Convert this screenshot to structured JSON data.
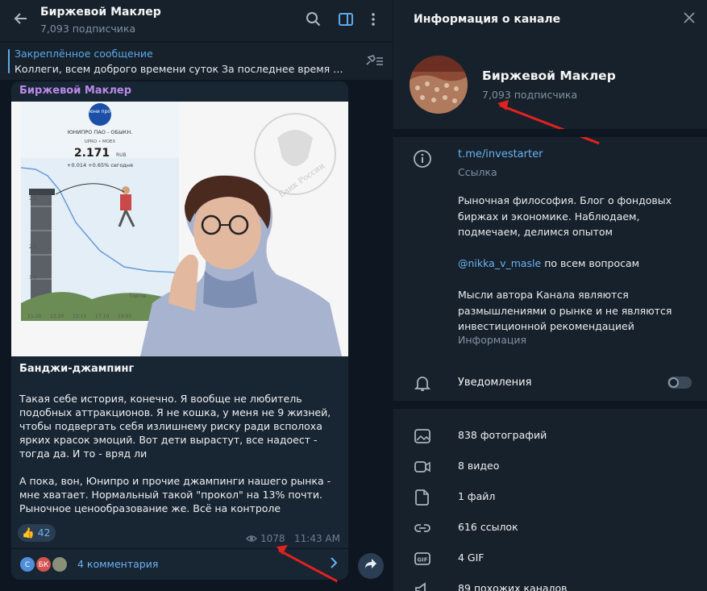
{
  "chat": {
    "title": "Биржевой Маклер",
    "subscribers": "7,093 подписчика"
  },
  "pinned": {
    "title": "Закреплённое сообщение",
    "text": "Коллеги, всем доброго времени суток  За последнее время к на..."
  },
  "post": {
    "author": "Биржевой Маклер",
    "image": {
      "ticker_name": "ЮНИПРО ПАО - ОБЫКН.",
      "ticker_code": "UPRO • MOEX",
      "logo_text": "юни про",
      "price": "2.171",
      "currency": "RUB",
      "change": "+0.014 +0.65% сегодня",
      "seal_text": "Банк России",
      "trade_label": "Торгов",
      "axis_y": [
        "2.2",
        "2.0",
        "1.9"
      ],
      "axis_x": [
        "11:20",
        "13:20",
        "15:15",
        "17:10",
        "19:05"
      ]
    },
    "heading": "Банджи-джампинг",
    "paragraphs": [
      "Такая себе история, конечно. Я вообще не любитель подобных аттракционов. Я не кошка, у меня не 9 жизней, чтобы подвергать себя излишнему риску ради всполоха ярких красок эмоций. Вот дети вырастут, все надоест - тогда да. И то - вряд ли",
      "А пока, вон, Юнипро и прочие джампинги нашего рынка - мне хватает. Нормальный такой \"прокол\" на 13% почти. Рыночное ценообразование же. Всё на контроле"
    ],
    "reaction_emoji": "👍",
    "reaction_count": "42",
    "views": "1078",
    "time": "11:43 AM",
    "comment_avatars": [
      "С",
      "БК"
    ],
    "comments_label": "4 комментария"
  },
  "info": {
    "title": "Информация о канале",
    "channel_name": "Биржевой Маклер",
    "subscribers": "7,093 подписчика",
    "link": "t.me/investarter",
    "link_caption": "Ссылка",
    "description": [
      "Рыночная философия. Блог о фондовых биржах и экономике. Наблюдаем, подмечаем, делимся опытом",
      "по всем вопросам",
      "Мысли автора Канала являются размышлениями о рынке и не являются инвестиционной рекомендацией"
    ],
    "mention": "@nikka_v_masle",
    "description_caption": "Информация",
    "notifications": "Уведомления",
    "notifications_on": false,
    "media": [
      {
        "icon": "photo-icon",
        "label": "838 фотографий"
      },
      {
        "icon": "video-icon",
        "label": "8 видео"
      },
      {
        "icon": "file-icon",
        "label": "1 файл"
      },
      {
        "icon": "link-icon",
        "label": "616 ссылок"
      },
      {
        "icon": "gif-icon",
        "label": "4 GIF"
      },
      {
        "icon": "similar-channels-icon",
        "label": "89 похожих каналов"
      }
    ]
  },
  "colors": {
    "accent": "#6ab3f3",
    "author": "#b78ae8",
    "annotation_arrow": "#e0221f"
  }
}
